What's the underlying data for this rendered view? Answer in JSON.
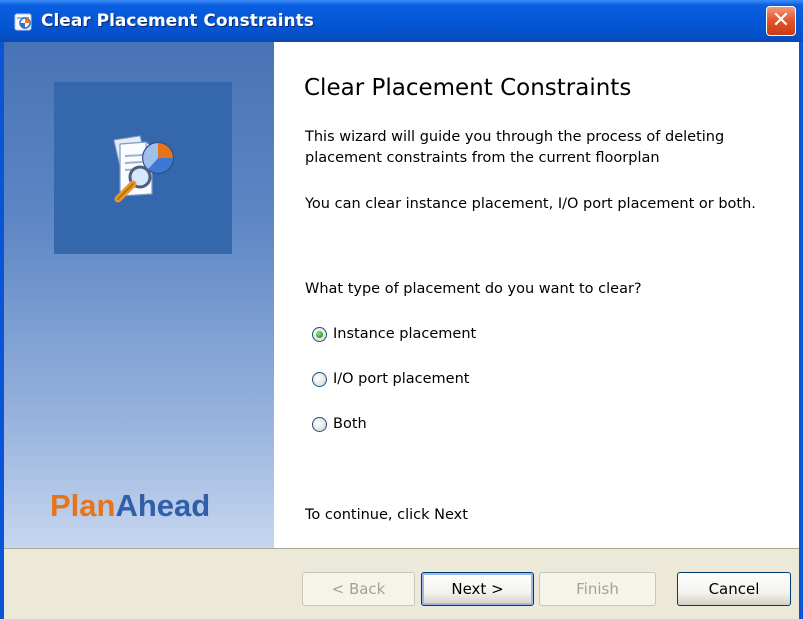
{
  "window": {
    "title": "Clear Placement Constraints",
    "close_glyph": "✕",
    "app_icon": "planahead-app-icon"
  },
  "sidebar": {
    "brand_part1": "Plan",
    "brand_part2": "Ahead",
    "illustration": "wizard-document-magnifier-icon",
    "colors": {
      "plan": "#e6751a",
      "ahead": "#2f5fa8"
    }
  },
  "main": {
    "heading": "Clear Placement Constraints",
    "intro": "This wizard will guide you through the process of deleting placement constraints from the current floorplan",
    "info": "You can clear instance placement, I/O port placement or both.",
    "question": "What type of placement do you want to clear?",
    "options": [
      {
        "label": "Instance placement",
        "selected": true
      },
      {
        "label": "I/O port placement",
        "selected": false
      },
      {
        "label": "Both",
        "selected": false
      }
    ],
    "continue_text": "To continue, click Next"
  },
  "buttons": {
    "back": "< Back",
    "next": "Next >",
    "finish": "Finish",
    "cancel": "Cancel"
  }
}
